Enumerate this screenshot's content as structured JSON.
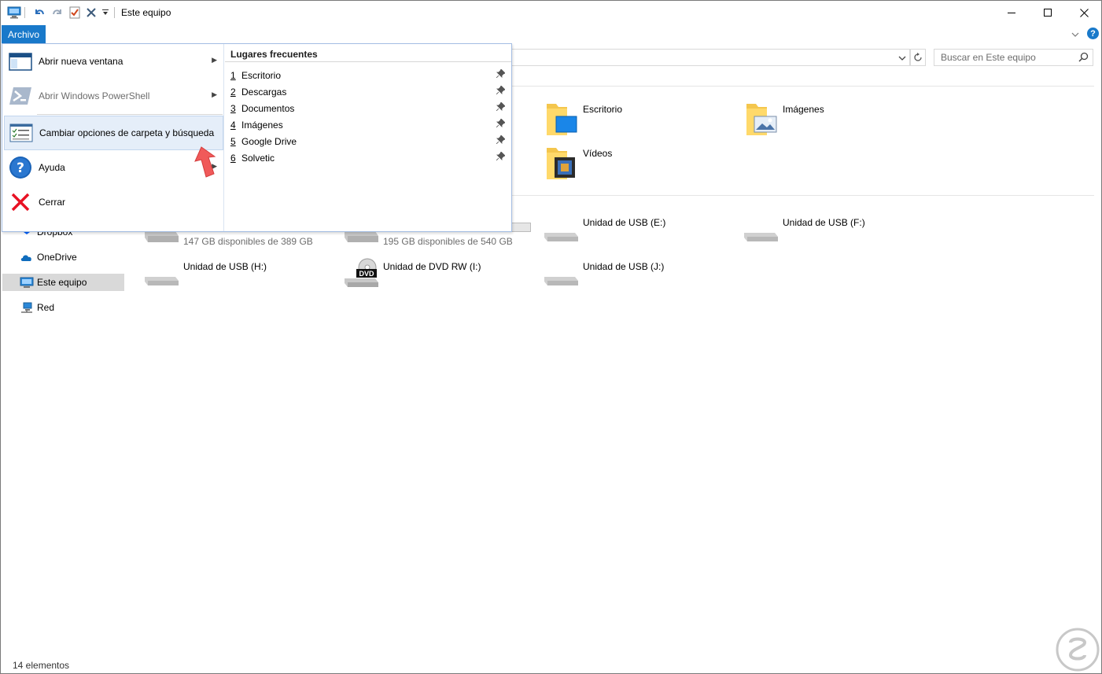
{
  "titlebar": {
    "title": "Este equipo",
    "icons": [
      "computer-icon",
      "undo-icon",
      "redo-icon",
      "properties-check-icon",
      "delete-x-icon",
      "customize-dropdown-icon"
    ],
    "controls": [
      "minimize",
      "maximize",
      "close"
    ]
  },
  "ribbon": {
    "file_tab": "Archivo"
  },
  "search": {
    "placeholder": "Buscar en Este equipo"
  },
  "file_menu": {
    "items": [
      {
        "label": "Abrir nueva ventana",
        "icon": "new-window-icon",
        "has_submenu": true,
        "disabled": false
      },
      {
        "label": "Abrir Windows PowerShell",
        "icon": "powershell-icon",
        "has_submenu": true,
        "disabled": true
      },
      {
        "label": "Cambiar opciones de carpeta y búsqueda",
        "icon": "folder-options-icon",
        "has_submenu": false,
        "highlighted": true
      },
      {
        "label": "Ayuda",
        "icon": "help-circle-icon",
        "has_submenu": true,
        "disabled": false
      },
      {
        "label": "Cerrar",
        "icon": "close-red-x-icon",
        "has_submenu": false,
        "disabled": false
      }
    ],
    "frequent": {
      "title": "Lugares frecuentes",
      "items": [
        {
          "num": "1",
          "label": "Escritorio"
        },
        {
          "num": "2",
          "label": "Descargas"
        },
        {
          "num": "3",
          "label": "Documentos"
        },
        {
          "num": "4",
          "label": "Imágenes"
        },
        {
          "num": "5",
          "label": "Google Drive"
        },
        {
          "num": "6",
          "label": "Solvetic"
        }
      ]
    }
  },
  "nav_pane": {
    "items": [
      {
        "label": "Dropbox",
        "icon": "dropbox-icon"
      },
      {
        "label": "OneDrive",
        "icon": "onedrive-cloud-icon"
      },
      {
        "label": "Este equipo",
        "icon": "computer-icon",
        "selected": true
      },
      {
        "label": "Red",
        "icon": "network-icon"
      }
    ]
  },
  "folders": [
    {
      "name": "Escritorio",
      "icon": "desktop-folder-icon"
    },
    {
      "name": "Imágenes",
      "icon": "pictures-folder-icon"
    },
    {
      "name": "Vídeos",
      "icon": "videos-folder-icon"
    }
  ],
  "drives": [
    {
      "name": "",
      "sub": "147 GB disponibles de 389 GB",
      "icon": "hard-drive-icon"
    },
    {
      "name": "",
      "sub": "195 GB disponibles de 540 GB",
      "icon": "hard-drive-icon"
    },
    {
      "name": "Unidad de USB (E:)",
      "sub": "",
      "icon": "usb-drive-icon"
    },
    {
      "name": "Unidad de USB (F:)",
      "sub": "",
      "icon": "usb-drive-icon"
    },
    {
      "name": "Unidad de USB (H:)",
      "sub": "",
      "icon": "usb-drive-icon"
    },
    {
      "name": "Unidad de DVD RW (I:)",
      "sub": "",
      "icon": "dvd-drive-icon"
    },
    {
      "name": "Unidad de USB (J:)",
      "sub": "",
      "icon": "usb-drive-icon"
    }
  ],
  "dvd_badge": "DVD",
  "status": {
    "count_text": "14 elementos"
  },
  "colors": {
    "accent": "#1979ca",
    "selection": "#d9d9d9",
    "menu_highlight": "#e5eef9",
    "close_red": "#e81123"
  }
}
